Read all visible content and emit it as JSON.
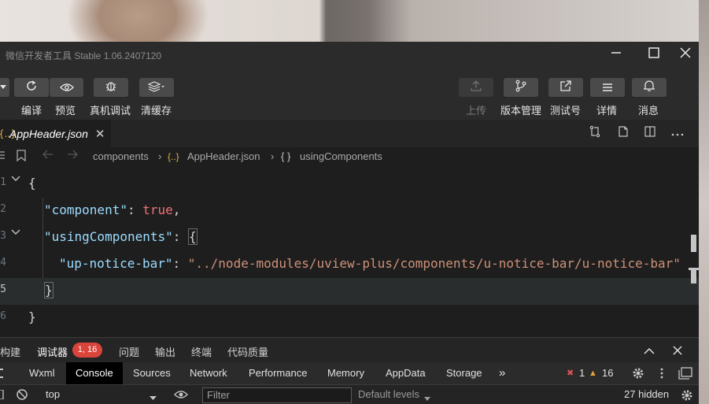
{
  "window": {
    "title": "微信开发者工具 Stable 1.06.2407120"
  },
  "toolbar": {
    "left": [
      {
        "label": "编译",
        "icon": "refresh-icon"
      },
      {
        "label": "预览",
        "icon": "eye-icon"
      },
      {
        "label": "真机调试",
        "icon": "bug-icon"
      },
      {
        "label": "清缓存",
        "icon": "layers-icon"
      }
    ],
    "right": [
      {
        "label": "上传",
        "icon": "upload-icon"
      },
      {
        "label": "版本管理",
        "icon": "branch-icon"
      },
      {
        "label": "测试号",
        "icon": "external-link-icon"
      },
      {
        "label": "详情",
        "icon": "menu-icon"
      },
      {
        "label": "消息",
        "icon": "bell-icon"
      }
    ]
  },
  "tab": {
    "icon": "{..}",
    "name": "AppHeader.json",
    "close": "✕"
  },
  "breadcrumb": {
    "folder": "components",
    "file": "AppHeader.json",
    "symbol": "usingComponents",
    "file_icon": "{..}",
    "symbol_icon": "{ }"
  },
  "editor": {
    "lines": [
      {
        "num": "1"
      },
      {
        "num": "2"
      },
      {
        "num": "3"
      },
      {
        "num": "4"
      },
      {
        "num": "5"
      },
      {
        "num": "6"
      }
    ],
    "tokens": {
      "open_brace": "{",
      "key_component": "\"component\"",
      "colon1": ": ",
      "val_true": "true",
      "comma1": ",",
      "key_using": "\"usingComponents\"",
      "colon2": ": ",
      "open_brace2": "{",
      "key_notice": "\"up-notice-bar\"",
      "colon3": ": ",
      "val_path": "\"../node-modules/uview-plus/components/u-notice-bar/u-notice-bar\"",
      "close_brace2": "}",
      "close_brace": "}"
    }
  },
  "panel": {
    "tabs": [
      "构建",
      "调试器",
      "问题",
      "输出",
      "终端",
      "代码质量"
    ],
    "badge": "1, 16"
  },
  "devtools": {
    "tabs": [
      "Wxml",
      "Console",
      "Sources",
      "Network",
      "Performance",
      "Memory",
      "AppData",
      "Storage"
    ],
    "more": "»",
    "errors": "1",
    "warnings": "16",
    "error_icon": "✖",
    "warning_icon": "▲"
  },
  "console": {
    "context": "top",
    "filter_placeholder": "Filter",
    "levels": "Default levels",
    "hidden": "27 hidden"
  }
}
